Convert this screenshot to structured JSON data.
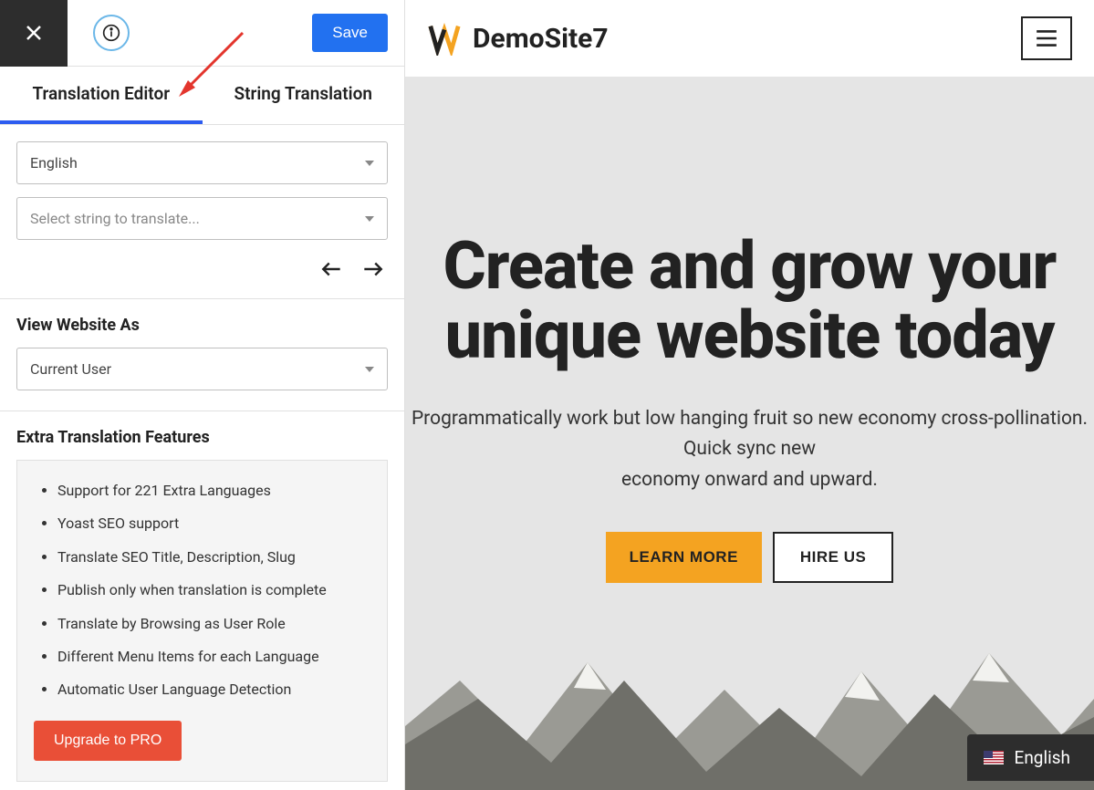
{
  "sidebar": {
    "save_label": "Save",
    "tabs": {
      "editor": "Translation Editor",
      "string": "String Translation"
    },
    "language_select": "English",
    "string_select_placeholder": "Select string to translate...",
    "view_as_label": "View Website As",
    "view_as_value": "Current User",
    "features_label": "Extra Translation Features",
    "features": [
      "Support for 221 Extra Languages",
      "Yoast SEO support",
      "Translate SEO Title, Description, Slug",
      "Publish only when translation is complete",
      "Translate by Browsing as User Role",
      "Different Menu Items for each Language",
      "Automatic User Language Detection"
    ],
    "upgrade_label": "Upgrade to PRO"
  },
  "preview": {
    "site_title": "DemoSite7",
    "hero_title_line1": "Create and grow your",
    "hero_title_line2": "unique website today",
    "hero_sub_line1": "Programmatically work but low hanging fruit so new economy cross-pollination.",
    "hero_sub_line2": "Quick sync new",
    "hero_sub_line3": "economy onward and upward.",
    "learn_more": "LEARN MORE",
    "hire_us": "HIRE US",
    "language_switcher": "English"
  },
  "colors": {
    "primary_blue": "#2271f0",
    "accent_orange": "#f4a321",
    "upgrade_red": "#e94f37"
  }
}
